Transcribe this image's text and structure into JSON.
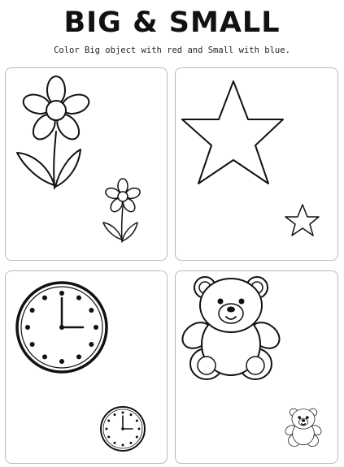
{
  "worksheet": {
    "title": "BIG & SMALL",
    "instructions": "Color Big object with red and Small with blue."
  },
  "panels": [
    {
      "subject": "flower",
      "icons": [
        "flower-big-icon",
        "flower-small-icon"
      ]
    },
    {
      "subject": "star",
      "icons": [
        "star-big-icon",
        "star-small-icon"
      ]
    },
    {
      "subject": "clock",
      "icons": [
        "clock-big-icon",
        "clock-small-icon"
      ]
    },
    {
      "subject": "teddy bear",
      "icons": [
        "teddy-bear-big-icon",
        "teddy-bear-small-icon"
      ]
    }
  ],
  "colors": {
    "line": "#111111",
    "panel_border": "#b9b9b9",
    "background": "#ffffff"
  }
}
